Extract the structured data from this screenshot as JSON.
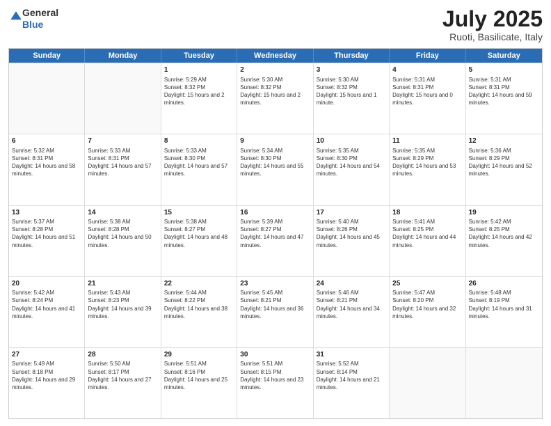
{
  "header": {
    "logo_general": "General",
    "logo_blue": "Blue",
    "month_year": "July 2025",
    "location": "Ruoti, Basilicate, Italy"
  },
  "days_of_week": [
    "Sunday",
    "Monday",
    "Tuesday",
    "Wednesday",
    "Thursday",
    "Friday",
    "Saturday"
  ],
  "weeks": [
    [
      {
        "day": "",
        "empty": true
      },
      {
        "day": "",
        "empty": true
      },
      {
        "day": "1",
        "sunrise": "Sunrise: 5:29 AM",
        "sunset": "Sunset: 8:32 PM",
        "daylight": "Daylight: 15 hours and 2 minutes."
      },
      {
        "day": "2",
        "sunrise": "Sunrise: 5:30 AM",
        "sunset": "Sunset: 8:32 PM",
        "daylight": "Daylight: 15 hours and 2 minutes."
      },
      {
        "day": "3",
        "sunrise": "Sunrise: 5:30 AM",
        "sunset": "Sunset: 8:32 PM",
        "daylight": "Daylight: 15 hours and 1 minute."
      },
      {
        "day": "4",
        "sunrise": "Sunrise: 5:31 AM",
        "sunset": "Sunset: 8:31 PM",
        "daylight": "Daylight: 15 hours and 0 minutes."
      },
      {
        "day": "5",
        "sunrise": "Sunrise: 5:31 AM",
        "sunset": "Sunset: 8:31 PM",
        "daylight": "Daylight: 14 hours and 59 minutes."
      }
    ],
    [
      {
        "day": "6",
        "sunrise": "Sunrise: 5:32 AM",
        "sunset": "Sunset: 8:31 PM",
        "daylight": "Daylight: 14 hours and 58 minutes."
      },
      {
        "day": "7",
        "sunrise": "Sunrise: 5:33 AM",
        "sunset": "Sunset: 8:31 PM",
        "daylight": "Daylight: 14 hours and 57 minutes."
      },
      {
        "day": "8",
        "sunrise": "Sunrise: 5:33 AM",
        "sunset": "Sunset: 8:30 PM",
        "daylight": "Daylight: 14 hours and 57 minutes."
      },
      {
        "day": "9",
        "sunrise": "Sunrise: 5:34 AM",
        "sunset": "Sunset: 8:30 PM",
        "daylight": "Daylight: 14 hours and 55 minutes."
      },
      {
        "day": "10",
        "sunrise": "Sunrise: 5:35 AM",
        "sunset": "Sunset: 8:30 PM",
        "daylight": "Daylight: 14 hours and 54 minutes."
      },
      {
        "day": "11",
        "sunrise": "Sunrise: 5:35 AM",
        "sunset": "Sunset: 8:29 PM",
        "daylight": "Daylight: 14 hours and 53 minutes."
      },
      {
        "day": "12",
        "sunrise": "Sunrise: 5:36 AM",
        "sunset": "Sunset: 8:29 PM",
        "daylight": "Daylight: 14 hours and 52 minutes."
      }
    ],
    [
      {
        "day": "13",
        "sunrise": "Sunrise: 5:37 AM",
        "sunset": "Sunset: 8:28 PM",
        "daylight": "Daylight: 14 hours and 51 minutes."
      },
      {
        "day": "14",
        "sunrise": "Sunrise: 5:38 AM",
        "sunset": "Sunset: 8:28 PM",
        "daylight": "Daylight: 14 hours and 50 minutes."
      },
      {
        "day": "15",
        "sunrise": "Sunrise: 5:38 AM",
        "sunset": "Sunset: 8:27 PM",
        "daylight": "Daylight: 14 hours and 48 minutes."
      },
      {
        "day": "16",
        "sunrise": "Sunrise: 5:39 AM",
        "sunset": "Sunset: 8:27 PM",
        "daylight": "Daylight: 14 hours and 47 minutes."
      },
      {
        "day": "17",
        "sunrise": "Sunrise: 5:40 AM",
        "sunset": "Sunset: 8:26 PM",
        "daylight": "Daylight: 14 hours and 45 minutes."
      },
      {
        "day": "18",
        "sunrise": "Sunrise: 5:41 AM",
        "sunset": "Sunset: 8:25 PM",
        "daylight": "Daylight: 14 hours and 44 minutes."
      },
      {
        "day": "19",
        "sunrise": "Sunrise: 5:42 AM",
        "sunset": "Sunset: 8:25 PM",
        "daylight": "Daylight: 14 hours and 42 minutes."
      }
    ],
    [
      {
        "day": "20",
        "sunrise": "Sunrise: 5:42 AM",
        "sunset": "Sunset: 8:24 PM",
        "daylight": "Daylight: 14 hours and 41 minutes."
      },
      {
        "day": "21",
        "sunrise": "Sunrise: 5:43 AM",
        "sunset": "Sunset: 8:23 PM",
        "daylight": "Daylight: 14 hours and 39 minutes."
      },
      {
        "day": "22",
        "sunrise": "Sunrise: 5:44 AM",
        "sunset": "Sunset: 8:22 PM",
        "daylight": "Daylight: 14 hours and 38 minutes."
      },
      {
        "day": "23",
        "sunrise": "Sunrise: 5:45 AM",
        "sunset": "Sunset: 8:21 PM",
        "daylight": "Daylight: 14 hours and 36 minutes."
      },
      {
        "day": "24",
        "sunrise": "Sunrise: 5:46 AM",
        "sunset": "Sunset: 8:21 PM",
        "daylight": "Daylight: 14 hours and 34 minutes."
      },
      {
        "day": "25",
        "sunrise": "Sunrise: 5:47 AM",
        "sunset": "Sunset: 8:20 PM",
        "daylight": "Daylight: 14 hours and 32 minutes."
      },
      {
        "day": "26",
        "sunrise": "Sunrise: 5:48 AM",
        "sunset": "Sunset: 8:19 PM",
        "daylight": "Daylight: 14 hours and 31 minutes."
      }
    ],
    [
      {
        "day": "27",
        "sunrise": "Sunrise: 5:49 AM",
        "sunset": "Sunset: 8:18 PM",
        "daylight": "Daylight: 14 hours and 29 minutes."
      },
      {
        "day": "28",
        "sunrise": "Sunrise: 5:50 AM",
        "sunset": "Sunset: 8:17 PM",
        "daylight": "Daylight: 14 hours and 27 minutes."
      },
      {
        "day": "29",
        "sunrise": "Sunrise: 5:51 AM",
        "sunset": "Sunset: 8:16 PM",
        "daylight": "Daylight: 14 hours and 25 minutes."
      },
      {
        "day": "30",
        "sunrise": "Sunrise: 5:51 AM",
        "sunset": "Sunset: 8:15 PM",
        "daylight": "Daylight: 14 hours and 23 minutes."
      },
      {
        "day": "31",
        "sunrise": "Sunrise: 5:52 AM",
        "sunset": "Sunset: 8:14 PM",
        "daylight": "Daylight: 14 hours and 21 minutes."
      },
      {
        "day": "",
        "empty": true
      },
      {
        "day": "",
        "empty": true
      }
    ]
  ]
}
